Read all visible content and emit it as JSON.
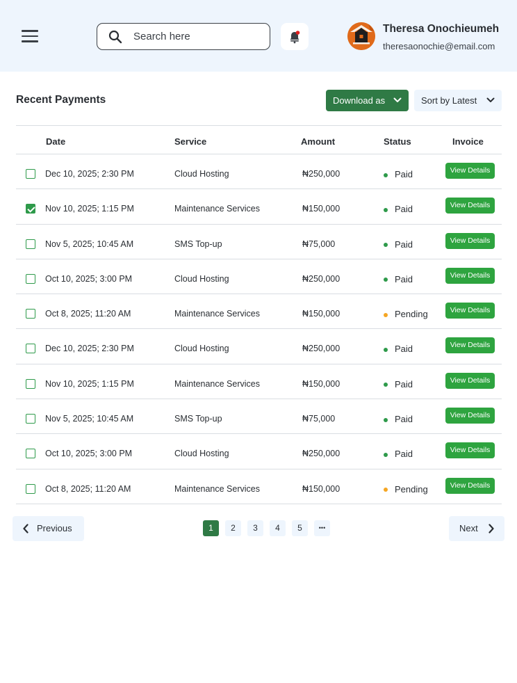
{
  "header": {
    "search_placeholder": "Search here",
    "user": {
      "name": "Theresa Onochieumeh",
      "email": "theresaonochie@email.com"
    },
    "icons": {
      "menu": "hamburger-icon",
      "search": "search-icon",
      "notification": "bell-icon",
      "avatar": "house-avatar-icon"
    },
    "notification_dot_color": "#e02020"
  },
  "payments": {
    "title": "Recent Payments",
    "download_label": "Download as",
    "sort_label": "Sort by Latest",
    "columns": {
      "date": "Date",
      "service": "Service",
      "amount": "Amount",
      "status": "Status",
      "invoice": "Invoice"
    },
    "view_label": "View Details",
    "rows": [
      {
        "date": "Dec 10, 2025; 2:30 PM",
        "service": "Cloud Hosting",
        "amount": "₦250,000",
        "status": "Paid",
        "checked": false
      },
      {
        "date": "Nov 10, 2025; 1:15 PM",
        "service": "Maintenance Services",
        "amount": "₦150,000",
        "status": "Paid",
        "checked": true
      },
      {
        "date": "Nov 5, 2025; 10:45 AM",
        "service": "SMS Top-up",
        "amount": "₦75,000",
        "status": "Paid",
        "checked": false
      },
      {
        "date": "Oct 10, 2025; 3:00 PM",
        "service": "Cloud Hosting",
        "amount": "₦250,000",
        "status": "Paid",
        "checked": false
      },
      {
        "date": "Oct 8, 2025; 11:20 AM",
        "service": "Maintenance Services",
        "amount": "₦150,000",
        "status": "Pending",
        "checked": false
      },
      {
        "date": "Dec 10, 2025; 2:30 PM",
        "service": "Cloud Hosting",
        "amount": "₦250,000",
        "status": "Paid",
        "checked": false
      },
      {
        "date": "Nov 10, 2025; 1:15 PM",
        "service": "Maintenance Services",
        "amount": "₦150,000",
        "status": "Paid",
        "checked": false
      },
      {
        "date": "Nov 5, 2025; 10:45 AM",
        "service": "SMS Top-up",
        "amount": "₦75,000",
        "status": "Paid",
        "checked": false
      },
      {
        "date": "Oct 10, 2025; 3:00 PM",
        "service": "Cloud Hosting",
        "amount": "₦250,000",
        "status": "Paid",
        "checked": false
      },
      {
        "date": "Oct 8, 2025; 11:20 AM",
        "service": "Maintenance Services",
        "amount": "₦150,000",
        "status": "Pending",
        "checked": false
      }
    ]
  },
  "pagination": {
    "previous_label": "Previous",
    "next_label": "Next",
    "pages": [
      "1",
      "2",
      "3",
      "4",
      "5"
    ],
    "current_page": "1",
    "ellipsis": "•••"
  },
  "colors": {
    "header_bg": "#eef5fd",
    "primary_green": "#2f7a45",
    "button_green": "#2ea43f",
    "paid": "#2e9a4a",
    "pending": "#f5a623",
    "avatar": "#e06a1a"
  }
}
